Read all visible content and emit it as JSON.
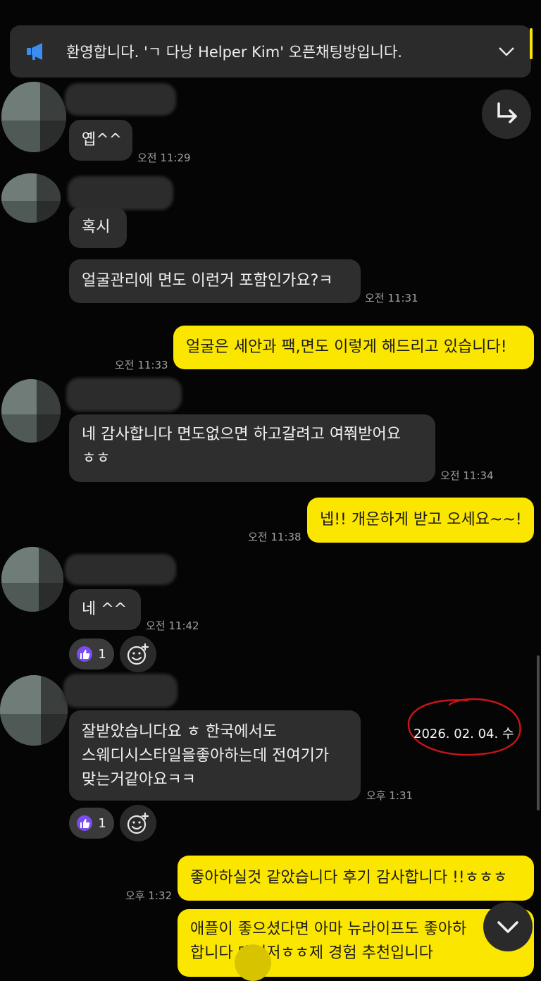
{
  "notice": {
    "text": "환영합니다. 'ㄱ 다낭 Helper Kim' 오픈채팅방입니다.",
    "icon": "megaphone-icon"
  },
  "messages": {
    "m1": {
      "text": "옙^^",
      "time": "오전 11:29"
    },
    "m2a": {
      "text": "혹시"
    },
    "m2b": {
      "text": "얼굴관리에 면도 이런거 포함인가요?ㅋ",
      "time": "오전 11:31"
    },
    "m3": {
      "text": "얼굴은 세안과 팩,면도 이렇게 해드리고 있습니다!",
      "time": "오전 11:33"
    },
    "m4": {
      "line1": "네 감사합니다 면도없으면 하고갈려고 여쭤받어요",
      "line2": "ㅎㅎ",
      "time": "오전 11:34"
    },
    "m5": {
      "text": "넵!! 개운하게 받고 오세요~~!",
      "time": "오전 11:38"
    },
    "m6": {
      "text": "네  ^^",
      "time": "오전 11:42",
      "reaction_count": "1"
    },
    "m7": {
      "line1": "잘받았습니다요 ㅎ  한국에서도",
      "line2": "스웨디시스타일을좋아하는데 전여기가",
      "line3": "맞는거같아요ㅋㅋ",
      "time": "오후 1:31",
      "reaction_count": "1"
    },
    "m8": {
      "text": "좋아하실것 같았습니다 후기 감사합니다 !!ㅎㅎㅎ",
      "time": "오후 1:32"
    },
    "m9": {
      "line1": "애플이 좋으셨다면 아마 뉴라이프도 좋아하",
      "line2": "합니다    매니저ㅎㅎ제 경험 추천입니다"
    }
  },
  "annotation": {
    "date": "2026. 02. 04. 수",
    "circle_color": "#c8141a"
  },
  "colors": {
    "mine_bubble": "#fbe600",
    "other_bubble": "#2e2e2e",
    "background": "#050505",
    "reaction": "#7b4df0"
  }
}
